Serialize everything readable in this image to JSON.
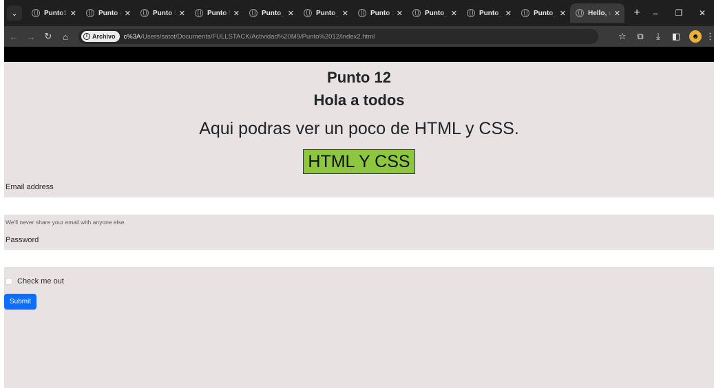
{
  "browser": {
    "tabs": [
      {
        "label": "Punto1.2",
        "active": false
      },
      {
        "label": "Punto 4",
        "active": false
      },
      {
        "label": "Punto 5",
        "active": false
      },
      {
        "label": "Punto 5i",
        "active": false
      },
      {
        "label": "Punto_s",
        "active": false
      },
      {
        "label": "Punto_9",
        "active": false
      },
      {
        "label": "Punto 1(",
        "active": false
      },
      {
        "label": "Punto_1",
        "active": false
      },
      {
        "label": "Punto_1",
        "active": false
      },
      {
        "label": "Punto_1",
        "active": false
      },
      {
        "label": "Hello, w",
        "active": true
      }
    ],
    "close_glyph": "✕",
    "new_tab_glyph": "+",
    "window_controls": [
      "–",
      "❐",
      "✕"
    ],
    "address_chip": "Archivo",
    "url_strong": "c%3A",
    "url_rest": "/Users/satot/Documents/FULLSTACK/Actividad%20M9/Punto%2012/index2.html"
  },
  "page": {
    "heading1": "Punto 12",
    "heading2": "Hola a todos",
    "lead": "Aqui podras ver un poco de HTML y CSS.",
    "badge": "HTML Y CSS",
    "form": {
      "email_label": "Email address",
      "email_value": "",
      "email_help": "We'll never share your email with anyone else.",
      "password_label": "Password",
      "password_value": "",
      "checkbox_label": "Check me out",
      "checkbox_checked": false,
      "submit_label": "Submit"
    }
  },
  "colors": {
    "page_bg": "#e8e2e2",
    "badge_bg": "#8dc63f",
    "submit_bg": "#0d6efd"
  }
}
